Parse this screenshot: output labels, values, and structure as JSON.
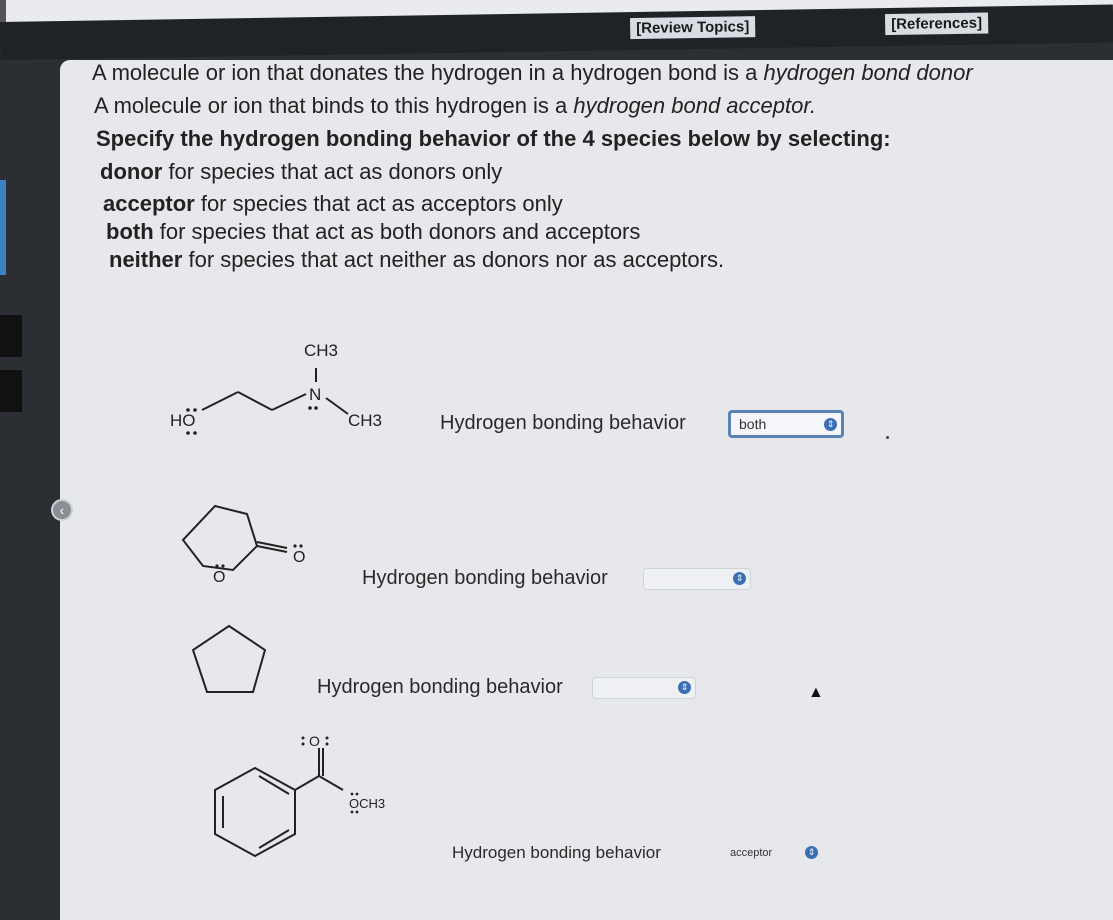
{
  "nav": {
    "review_topics": "[Review Topics]",
    "references": "[References]"
  },
  "intro": {
    "line1_pre": "A molecule or ion that donates the hydrogen in a hydrogen bond is a ",
    "line1_term": "hydrogen bond donor",
    "line2_pre": "A molecule or ion that binds to this hydrogen is a ",
    "line2_term": "hydrogen bond acceptor.",
    "instruction": "Specify the hydrogen bonding behavior of the 4 species below by selecting:",
    "options": [
      {
        "term": "donor",
        "desc": " for species that act as donors only"
      },
      {
        "term": "acceptor",
        "desc": " for species that act as acceptors only"
      },
      {
        "term": "both",
        "desc": " for species that act as both donors and acceptors"
      },
      {
        "term": "neither",
        "desc": " for species that act neither as donors nor as acceptors."
      }
    ]
  },
  "questions": [
    {
      "label": "Hydrogen bonding behavior",
      "selected": "both"
    },
    {
      "label": "Hydrogen bonding behavior",
      "selected": ""
    },
    {
      "label": "Hydrogen bonding behavior",
      "selected": ""
    },
    {
      "label": "Hydrogen bonding behavior",
      "selected": "acceptor"
    }
  ],
  "molecules": {
    "mol1": {
      "ch3_top": "CH3",
      "n": "N",
      "ch3_right": "CH3",
      "ho": "HO"
    },
    "mol2": {
      "o_ring": "O",
      "o_double": "O"
    },
    "mol4": {
      "o_carbonyl": "O",
      "och3": "OCH3"
    }
  },
  "icons": {
    "select_icon": "updown-chevron-icon",
    "collapse_icon": "chevron-left-icon",
    "cursor_icon": "mouse-pointer-icon"
  },
  "colors": {
    "select_icon": "#3a6fb4",
    "active_border": "#5a83b5",
    "header": "#1f2226"
  }
}
